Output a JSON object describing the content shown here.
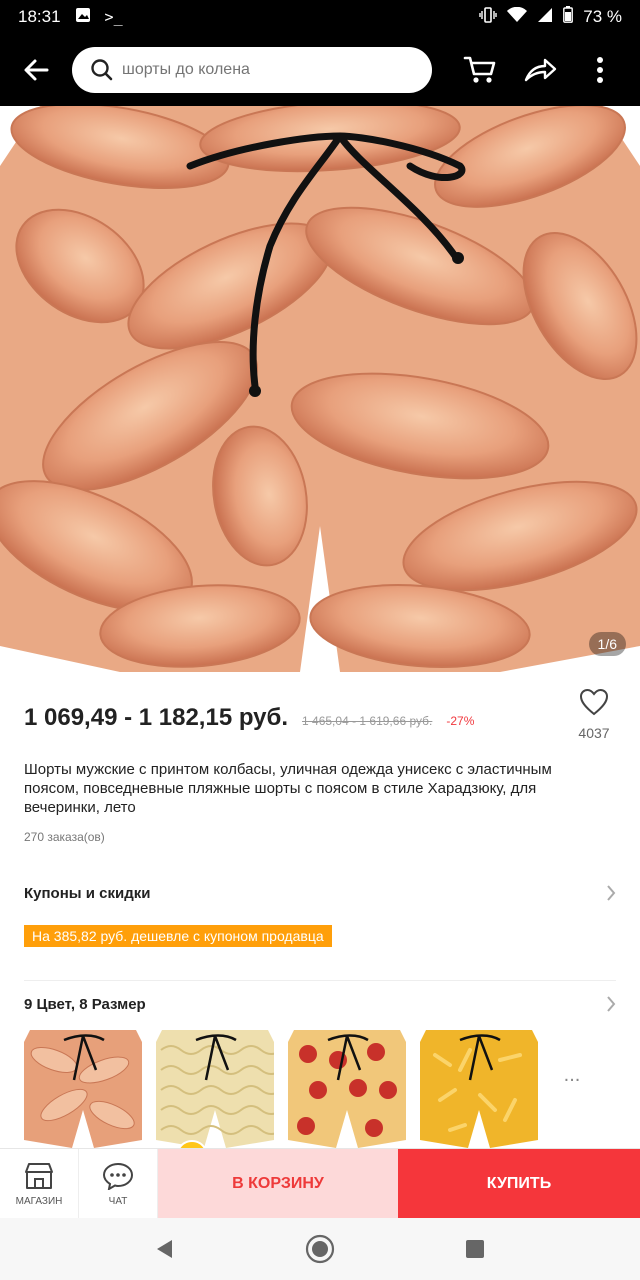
{
  "status": {
    "time": "18:31",
    "battery": "73 %"
  },
  "search": {
    "placeholder": "шорты до колена"
  },
  "hero": {
    "counter": "1/6"
  },
  "product": {
    "price": "1 069,49 - 1 182,15 руб.",
    "old_price": "1 465,04 - 1 619,66 руб.",
    "discount": "-27%",
    "favorites": "4037",
    "title": "Шорты мужские с принтом колбасы, уличная одежда унисекс с эластичным поясом, повседневные пляжные шорты с поясом в стиле Харадзюку, для вечеринки, лето",
    "orders": "270 заказа(ов)"
  },
  "coupons": {
    "heading": "Купоны и скидки",
    "badge": "На 385,82 руб. дешевле с купоном продавца"
  },
  "variants": {
    "heading": "9 Цвет, 8 Размер",
    "more": "..."
  },
  "actions": {
    "store": "МАГАЗИН",
    "chat": "ЧАТ",
    "cart": "В КОРЗИНУ",
    "buy": "КУПИТЬ"
  },
  "colors": {
    "accent": "#f5363b",
    "coupon": "#ff9f0a"
  }
}
